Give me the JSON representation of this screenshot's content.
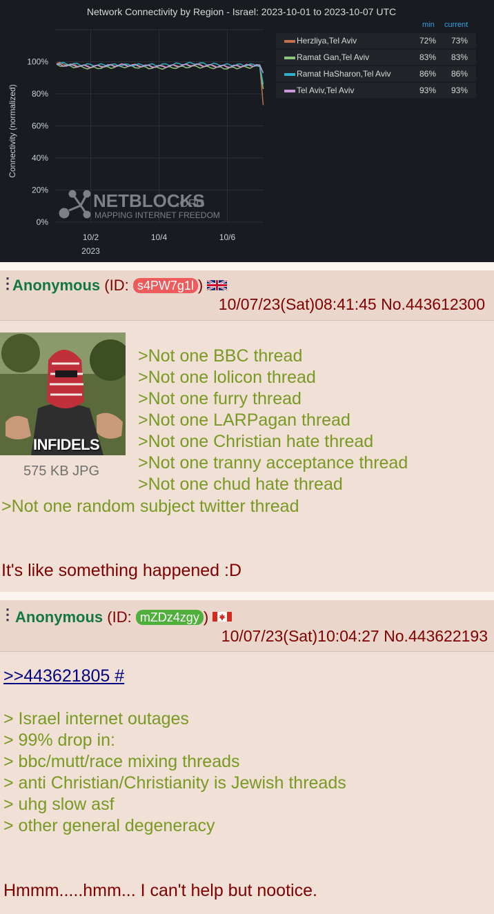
{
  "chart": {
    "title": "Network Connectivity by Region - Israel: 2023-10-01 to 2023-10-07 UTC",
    "ylabel": "Connectivity (normalized)",
    "legend_headers": {
      "min": "min",
      "current": "current"
    },
    "watermark": {
      "brand": "NETBLOCKS",
      "tld": ".ORG",
      "tagline": "MAPPING INTERNET FREEDOM"
    }
  },
  "chart_data": {
    "type": "line",
    "title": "Network Connectivity by Region - Israel: 2023-10-01 to 2023-10-07 UTC",
    "ylabel": "Connectivity (normalized)",
    "xlabel": "",
    "x_ticks": [
      "10/2",
      "10/4",
      "10/6"
    ],
    "x_year_label": "2023",
    "y_ticks": [
      "0%",
      "20%",
      "40%",
      "60%",
      "80%",
      "100%"
    ],
    "ylim": [
      0,
      120
    ],
    "x": [
      "10/1",
      "10/2",
      "10/3",
      "10/4",
      "10/5",
      "10/6",
      "10/7",
      "10/7 end"
    ],
    "grid": true,
    "legend_position": "right",
    "series": [
      {
        "name": "Herzliya,Tel Aviv",
        "color": "#c0704f",
        "min": "72%",
        "current": "73%",
        "values": [
          99,
          97,
          98,
          97,
          98,
          97,
          98,
          73
        ]
      },
      {
        "name": "Ramat Gan,Tel Aviv",
        "color": "#8fc47c",
        "min": "83%",
        "current": "83%",
        "values": [
          98,
          96,
          97,
          96,
          97,
          96,
          97,
          83
        ]
      },
      {
        "name": "Ramat HaSharon,Tel Aviv",
        "color": "#2fb0c9",
        "min": "86%",
        "current": "86%",
        "values": [
          99,
          98,
          98,
          98,
          99,
          98,
          98,
          86
        ]
      },
      {
        "name": "Tel Aviv,Tel Aviv",
        "color": "#c79bd9",
        "min": "93%",
        "current": "93%",
        "values": [
          98,
          97,
          98,
          97,
          98,
          97,
          98,
          93
        ]
      }
    ]
  },
  "post1": {
    "name": "Anonymous",
    "id": "s4PW7g1l",
    "id_color": "#ef5a5a",
    "flag": "uk-flag-icon",
    "datetime": "10/07/23(Sat)08:41:45",
    "number": "No.443612300",
    "image_label": "INFIDELS",
    "file_info": "575 KB JPG",
    "greentext": [
      ">Not one BBC thread",
      ">Not one lolicon thread",
      ">Not one furry thread",
      ">Not one LARPagan thread",
      ">Not one Christian hate thread",
      ">Not one tranny acceptance thread",
      ">Not one chud hate thread",
      ">Not one random subject twitter thread"
    ],
    "text": "It's like something happened :D"
  },
  "post2": {
    "name": "Anonymous",
    "id": "mZDz4zgy",
    "id_color": "#4fb03c",
    "flag": "canada-flag-icon",
    "datetime": "10/07/23(Sat)10:04:27",
    "number": "No.443622193",
    "quote": ">>443621805 #",
    "greentext": [
      "> Israel internet outages",
      "> 99% drop in:",
      "> bbc/mutt/race mixing threads",
      "> anti Christian/Christianity is Jewish threads",
      "> uhg slow asf",
      "> other general degeneracy"
    ],
    "text": "Hmmm.....hmm... I can't help but nootice."
  }
}
